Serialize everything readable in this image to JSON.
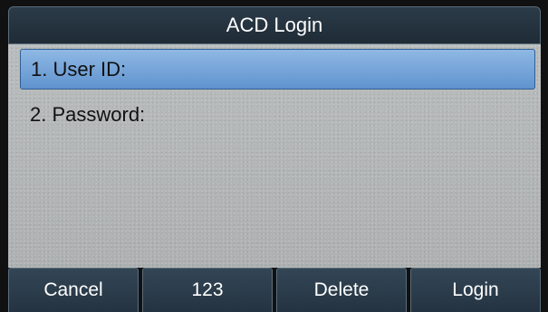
{
  "screen": {
    "title": "ACD Login"
  },
  "menu": {
    "items": [
      {
        "label": "1. User ID:",
        "selected": true
      },
      {
        "label": "2. Password:",
        "selected": false
      }
    ]
  },
  "softkeys": [
    {
      "label": "Cancel"
    },
    {
      "label": "123"
    },
    {
      "label": "Delete"
    },
    {
      "label": "Login"
    }
  ],
  "colors": {
    "title_bg": "#1f2c37",
    "content_bg": "#b4b7b8",
    "selected_item": "#6f9fd6",
    "softkey_bg": "#2b3b48"
  }
}
